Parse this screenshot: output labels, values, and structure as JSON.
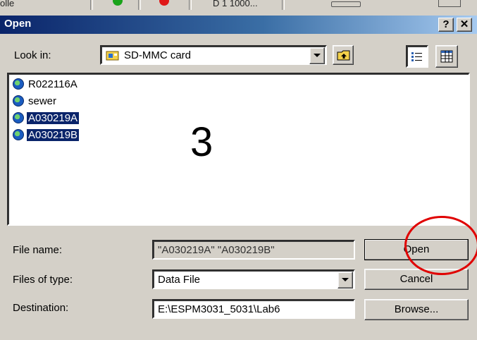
{
  "background": {
    "partial_text_left": "olle",
    "partial_text_mid": "D 1 1000..."
  },
  "dialog": {
    "title": "Open",
    "help_label": "?",
    "close_label": "✕",
    "look_in_label": "Look in:",
    "look_in_value": "SD-MMC card",
    "files": [
      {
        "name": "R022116A",
        "selected": false
      },
      {
        "name": "sewer",
        "selected": false
      },
      {
        "name": "A030219A",
        "selected": true
      },
      {
        "name": "A030219B",
        "selected": true
      }
    ],
    "overlay_number": "3",
    "file_name_label": "File name:",
    "file_name_value": "\"A030219A\" \"A030219B\"",
    "files_of_type_label": "Files of type:",
    "files_of_type_value": "Data File",
    "destination_label": "Destination:",
    "destination_value": "E:\\ESPM3031_5031\\Lab6",
    "open_button": "Open",
    "cancel_button": "Cancel",
    "browse_button": "Browse..."
  },
  "colors": {
    "title_gradient_start": "#0a246a",
    "selection": "#0a246a",
    "annotation_circle": "#e00000"
  }
}
